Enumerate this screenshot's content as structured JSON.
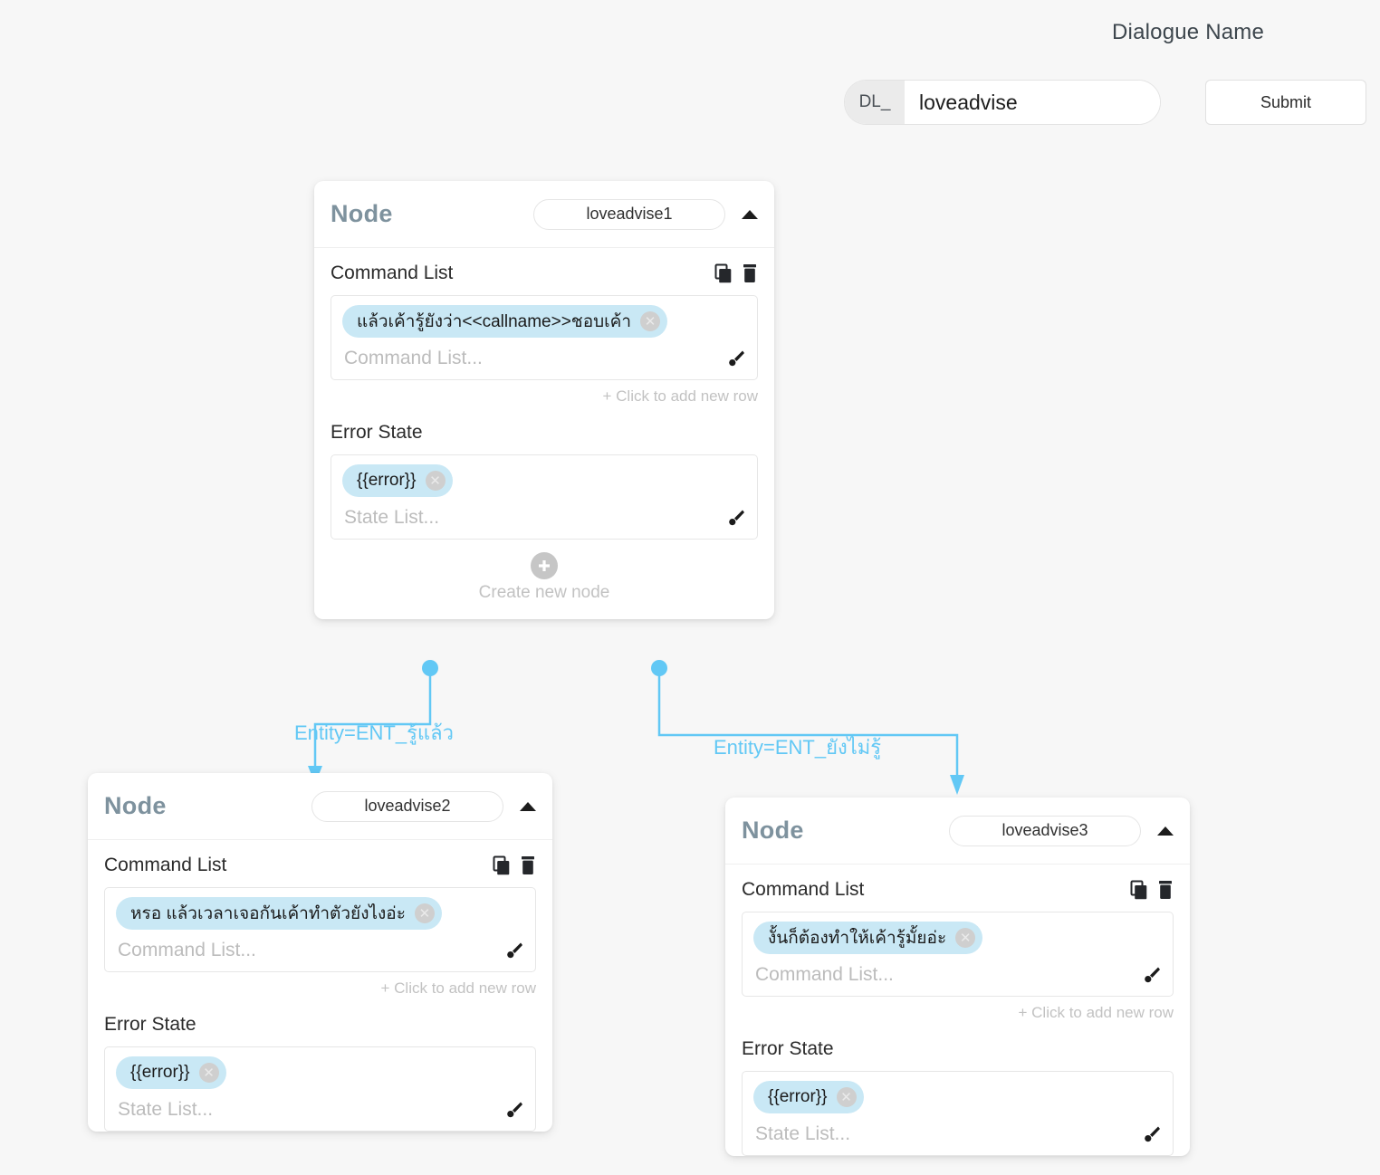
{
  "header": {
    "dialogue_name_label": "Dialogue Name",
    "name_prefix": "DL_",
    "name_value": "loveadvise",
    "name_placeholder": "",
    "submit_label": "Submit"
  },
  "labels": {
    "node_title": "Node",
    "command_list_label": "Command List",
    "command_list_placeholder": "Command List...",
    "error_state_label": "Error State",
    "state_list_placeholder": "State List...",
    "add_new_row": "+ Click to add new row",
    "create_new_node": "Create new node",
    "copy_icon": "copy-icon",
    "delete_icon": "trash-icon",
    "edit_icon": "brush-icon",
    "collapse_icon": "chevron-up-icon",
    "chip_remove_icon": "circle-x-icon",
    "plus_icon": "plus-icon"
  },
  "nodes": [
    {
      "id": "loveadvise1",
      "title": "Node",
      "command_list_label": "Command List",
      "commands": [
        "แล้วเค้ารู้ยังว่า<<callname>>ชอบเค้า"
      ],
      "command_placeholder": "Command List...",
      "add_new_row": "+ Click to add new row",
      "error_state_label": "Error State",
      "error_states": [
        "{{error}}"
      ],
      "state_placeholder": "State List...",
      "create_new_node": "Create new node"
    },
    {
      "id": "loveadvise2",
      "title": "Node",
      "command_list_label": "Command List",
      "commands": [
        "หรอ แล้วเวลาเจอกันเค้าทำตัวยังไงอ่ะ"
      ],
      "command_placeholder": "Command List...",
      "add_new_row": "+ Click to add new row",
      "error_state_label": "Error State",
      "error_states": [
        "{{error}}"
      ],
      "state_placeholder": "State List..."
    },
    {
      "id": "loveadvise3",
      "title": "Node",
      "command_list_label": "Command List",
      "commands": [
        "งั้นก็ต้องทำให้เค้ารู้มั้ยอ่ะ"
      ],
      "command_placeholder": "Command List...",
      "add_new_row": "+ Click to add new row",
      "error_state_label": "Error State",
      "error_states": [
        "{{error}}"
      ],
      "state_placeholder": "State List..."
    }
  ],
  "connectors": [
    {
      "label": "Entity=ENT_รู้แล้ว",
      "from": "loveadvise1",
      "to": "loveadvise2"
    },
    {
      "label": "Entity=ENT_ยังไม่รู้",
      "from": "loveadvise1",
      "to": "loveadvise3"
    }
  ],
  "colors": {
    "page_background": "#f7f7f7",
    "node_title": "#7e929e",
    "chip_background": "#c9e8f5",
    "connector": "#62c8f5",
    "muted_text": "#c2c2c2"
  }
}
